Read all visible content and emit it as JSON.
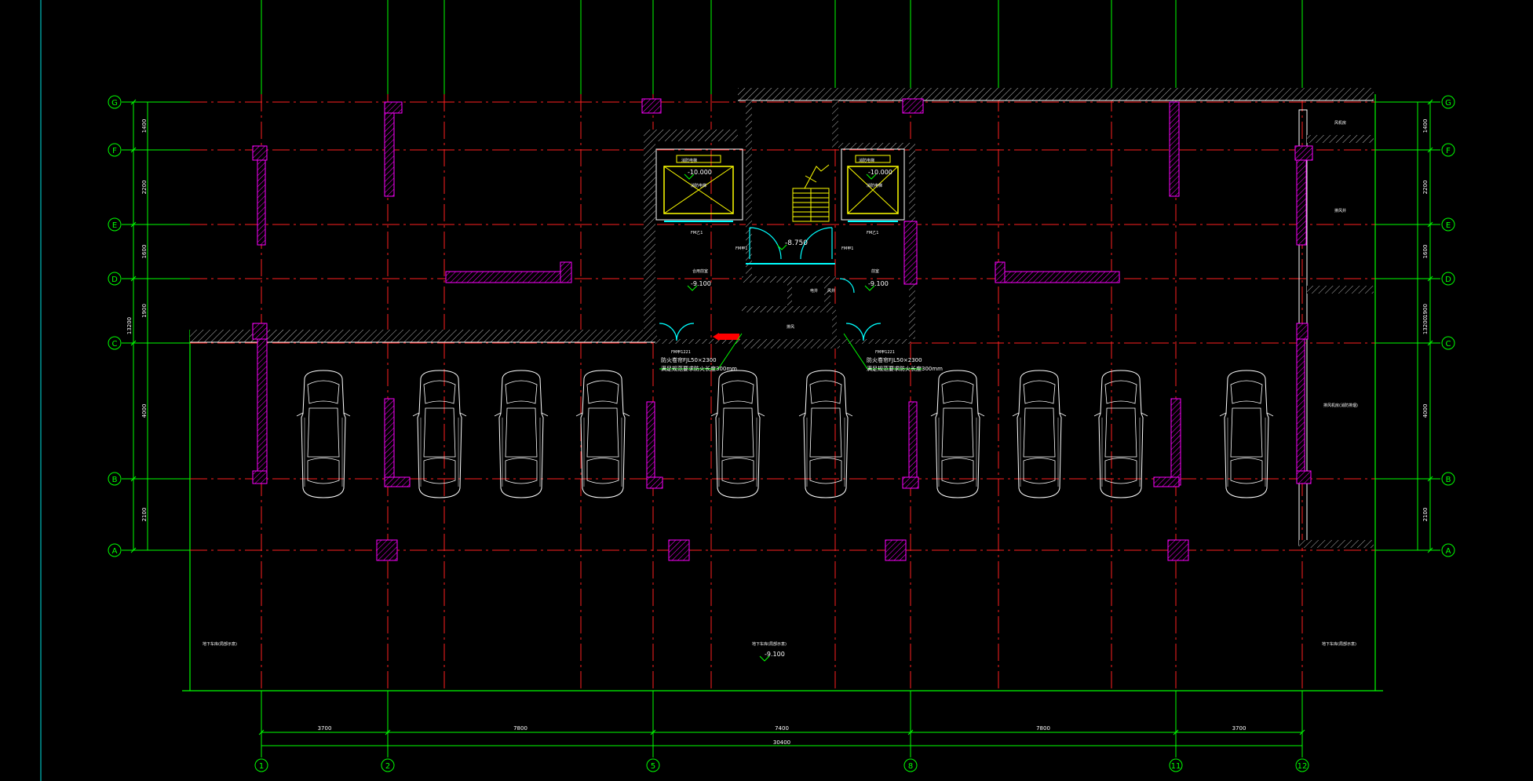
{
  "drawing": {
    "colors": {
      "background": "#000000",
      "grid_red": "#ff2020",
      "grid_green": "#00ff00",
      "wall_white": "#ffffff",
      "column_magenta": "#ff00ff",
      "door_cyan": "#00ffff",
      "elevator_yellow": "#ffff00",
      "text_white": "#ffffff",
      "marker_red": "#ff0000"
    },
    "grid_lines": {
      "vertical": [
        {
          "label": "1"
        },
        {
          "label": "2"
        },
        {
          "label": "5"
        },
        {
          "label": "8"
        },
        {
          "label": "11"
        },
        {
          "label": "12"
        }
      ],
      "horizontal": [
        {
          "label": "G"
        },
        {
          "label": "F"
        },
        {
          "label": "E"
        },
        {
          "label": "D"
        },
        {
          "label": "C"
        },
        {
          "label": "B"
        },
        {
          "label": "A"
        }
      ]
    },
    "dimensions": {
      "bottom_spans": [
        "3700",
        "7800",
        "7400",
        "7800",
        "3700"
      ],
      "bottom_total": "30400",
      "left_spans": [
        "1400",
        "2200",
        "1600",
        "1900",
        "4000",
        "2100"
      ],
      "left_total": "13200",
      "right_spans": [
        "1400",
        "2200",
        "1600",
        "1900",
        "4000",
        "2100"
      ],
      "right_total": "13200"
    },
    "levels": {
      "elevator_left": "-10.000",
      "elevator_right": "-10.000",
      "stair_landing": "-8.750",
      "lobby_left": "-9.100",
      "lobby_right": "-9.100",
      "parking_center": "-9.100"
    },
    "room_labels": {
      "elevator_left_top": "消防电梯",
      "elevator_right_top": "消防电梯",
      "elevator_shaft_left": "消防电梯",
      "elevator_shaft_right": "消防电梯",
      "lobby_left": "合用前室",
      "lobby_right": "前室",
      "room_small": "电井",
      "room_small2": "风井",
      "fire_left": "FM甲1",
      "fire_right": "FM甲1",
      "stair_door_left": "FM乙1",
      "stair_door_right": "FM乙1",
      "door_left_code": "FM甲1221",
      "door_right_code": "FM甲1221",
      "note_left_1": "防火卷帘FJL50×2300",
      "note_left_2": "满足规范要求防火长度300mm",
      "note_right_1": "防火卷帘FJL50×2300",
      "note_right_2": "满足规范要求防火长度300mm",
      "right_room_1": "风机房",
      "right_room_2": "排风井",
      "right_room_3": "排风机房(消防排烟)",
      "parking_left": "地下车库(局部示意)",
      "parking_center": "地下车库(局部示意)",
      "parking_right": "地下车库(局部示意)",
      "small_room": "排风"
    }
  }
}
